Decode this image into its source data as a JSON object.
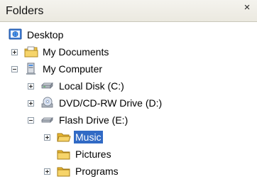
{
  "panel": {
    "title": "Folders",
    "close_glyph": "×"
  },
  "tree": [
    {
      "label": "Desktop",
      "icon": "desktop-icon",
      "expander": "none"
    },
    {
      "label": "My Documents",
      "icon": "my-documents-icon",
      "expander": "collapsed"
    },
    {
      "label": "My Computer",
      "icon": "my-computer-icon",
      "expander": "expanded"
    },
    {
      "label": "Local Disk (C:)",
      "icon": "hard-disk-icon",
      "expander": "collapsed"
    },
    {
      "label": "DVD/CD-RW Drive (D:)",
      "icon": "cd-drive-icon",
      "expander": "collapsed"
    },
    {
      "label": "Flash Drive (E:)",
      "icon": "flash-drive-icon",
      "expander": "expanded"
    },
    {
      "label": "Music",
      "icon": "folder-open-icon",
      "expander": "collapsed",
      "selected": true
    },
    {
      "label": "Pictures",
      "icon": "folder-icon",
      "expander": "none"
    },
    {
      "label": "Programs",
      "icon": "folder-icon",
      "expander": "collapsed"
    }
  ],
  "colors": {
    "selection": "#316ac5",
    "folder": "#f3c74b"
  }
}
